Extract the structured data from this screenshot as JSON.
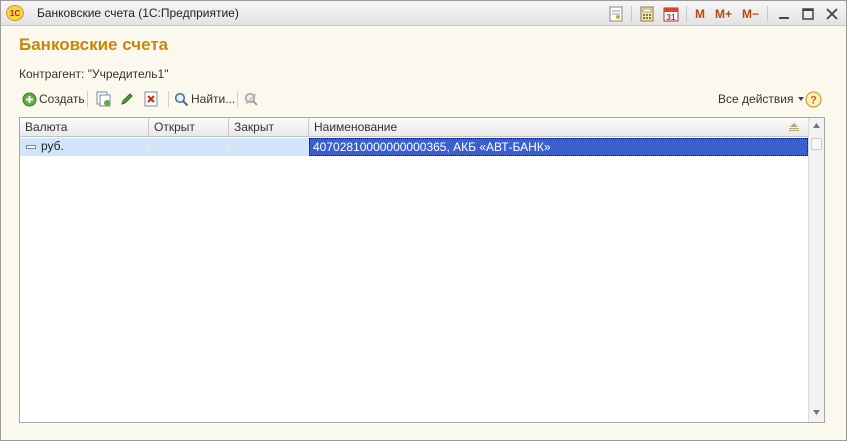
{
  "window": {
    "title": "Банковские счета  (1С:Предприятие)",
    "app_logo_text": "1С"
  },
  "title_icons": [
    "document-icon",
    "calculator-icon",
    "calendar-icon"
  ],
  "calendar_day": "31",
  "memory_buttons": [
    "M",
    "M+",
    "M−"
  ],
  "form": {
    "title": "Банковские счета",
    "kontragent_label": "Контрагент: \"Учредитель1\""
  },
  "toolbar": {
    "create_label": "Создать",
    "find_label": "Найти...",
    "all_actions_label": "Все действия"
  },
  "table": {
    "columns": [
      "Валюта",
      "Открыт",
      "Закрыт",
      "Наименование"
    ],
    "rows": [
      {
        "currency": "руб.",
        "opened": "",
        "closed": "",
        "name": "40702810000000000365, АКБ «АВТ-БАНК»"
      }
    ]
  },
  "colors": {
    "title_accent": "#c9870a",
    "row_highlight": "#d2e5f9",
    "selected_cell": "#3c5fd0"
  }
}
